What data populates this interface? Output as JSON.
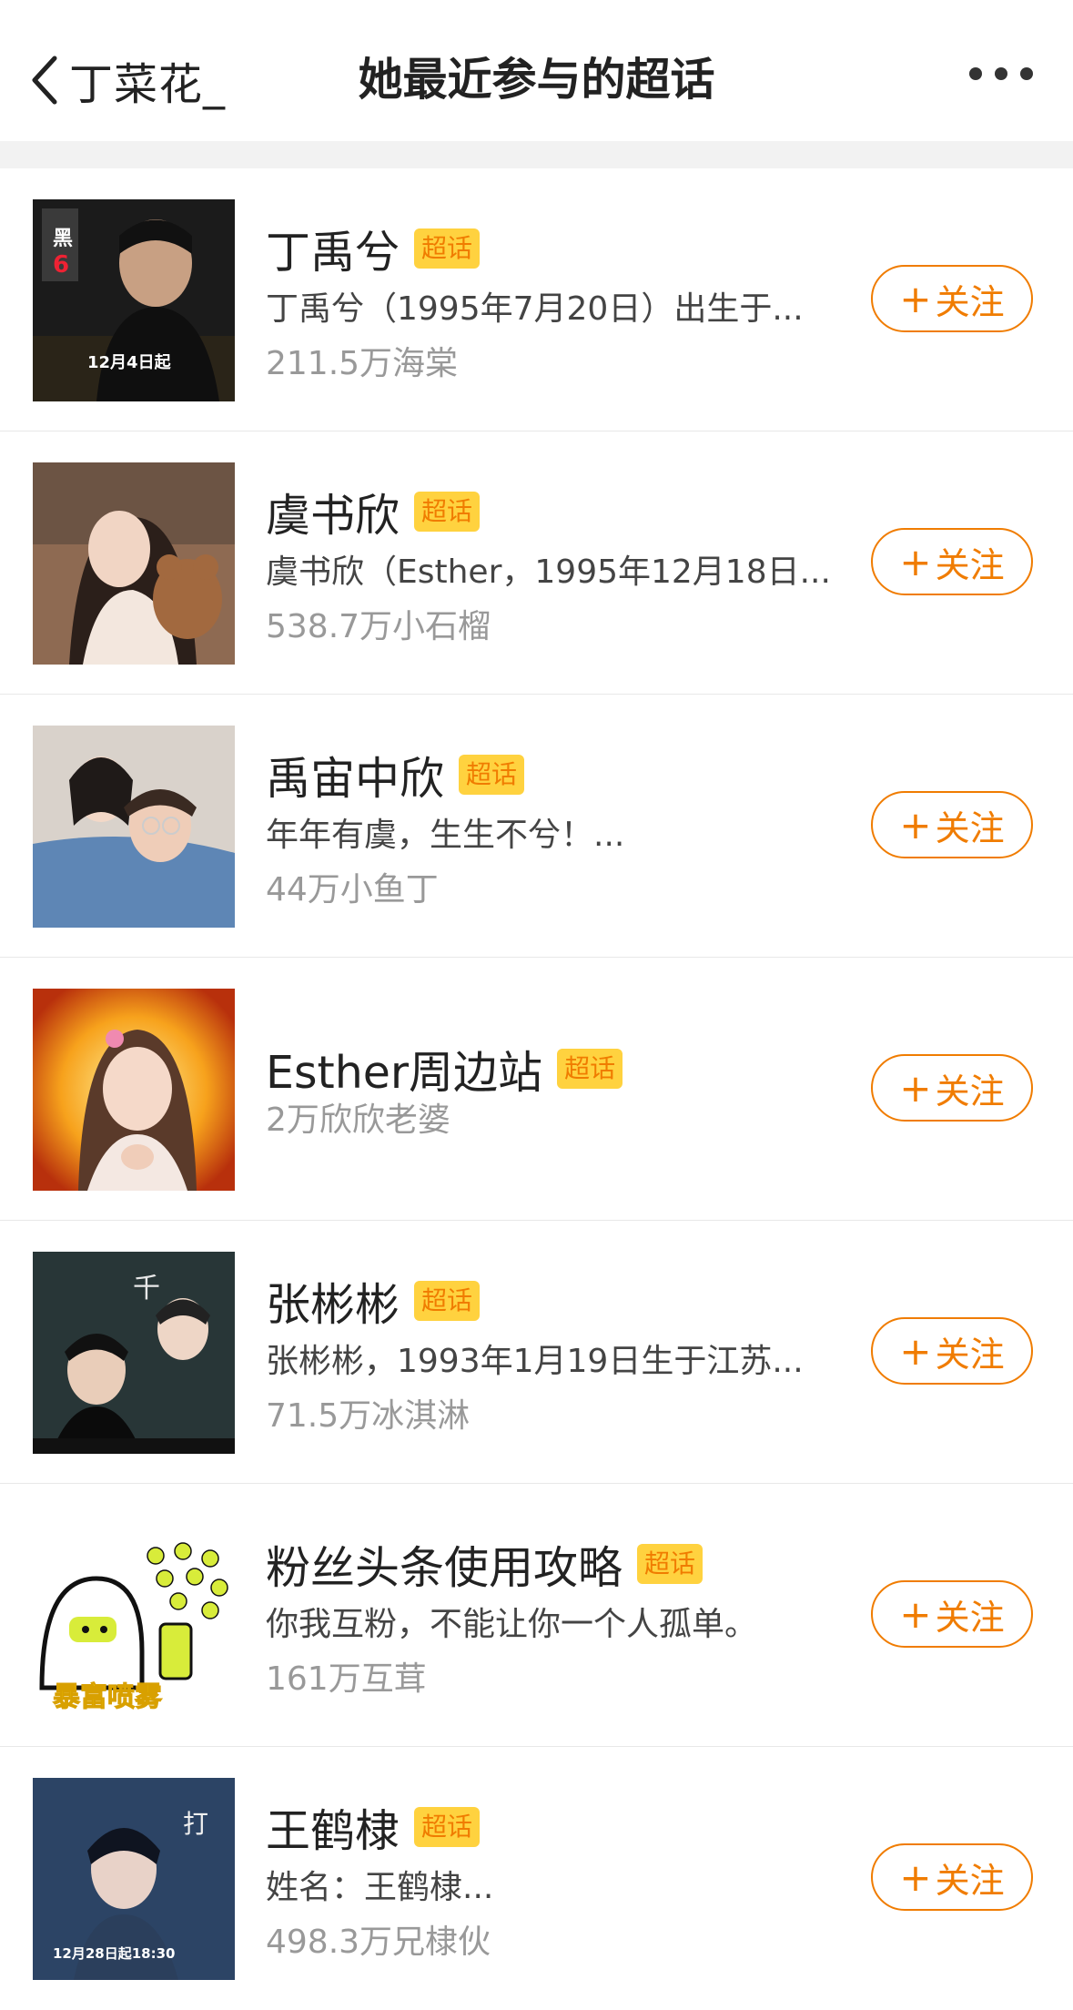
{
  "header": {
    "back_label": "丁菜花_",
    "title": "她最近参与的超话"
  },
  "badge_label": "超话",
  "follow_plus": "+",
  "follow_label": "关注",
  "items": [
    {
      "name": "丁禹兮",
      "desc": "丁禹兮（1995年7月20日）出生于...",
      "meta": "211.5万海棠",
      "thumb_text": "12月4日起"
    },
    {
      "name": "虞书欣",
      "desc": "虞书欣（Esther，1995年12月18日...",
      "meta": "538.7万小石榴",
      "thumb_text": ""
    },
    {
      "name": "禹宙中欣",
      "desc": "年年有虞，生生不兮！...",
      "meta": "44万小鱼丁",
      "thumb_text": ""
    },
    {
      "name": "Esther周边站",
      "desc": "",
      "meta": "2万欣欣老婆",
      "thumb_text": ""
    },
    {
      "name": "张彬彬",
      "desc": "张彬彬，1993年1月19日生于江苏...",
      "meta": "71.5万冰淇淋",
      "thumb_text": ""
    },
    {
      "name": "粉丝头条使用攻略",
      "desc": "你我互粉，不能让你一个人孤单。",
      "meta": "161万互茸",
      "thumb_text": "暴富喷雾"
    },
    {
      "name": "王鹤棣",
      "desc": "姓名：王鹤棣...",
      "meta": "498.3万兄棣伙",
      "thumb_text": "12月28日起18:30"
    }
  ],
  "colors": {
    "accent": "#f07c00",
    "badge_bg": "#ffd23f",
    "meta": "#999999",
    "divider": "#f2f2f2"
  },
  "icons": [
    "chevron-left-icon",
    "more-dots-icon"
  ]
}
